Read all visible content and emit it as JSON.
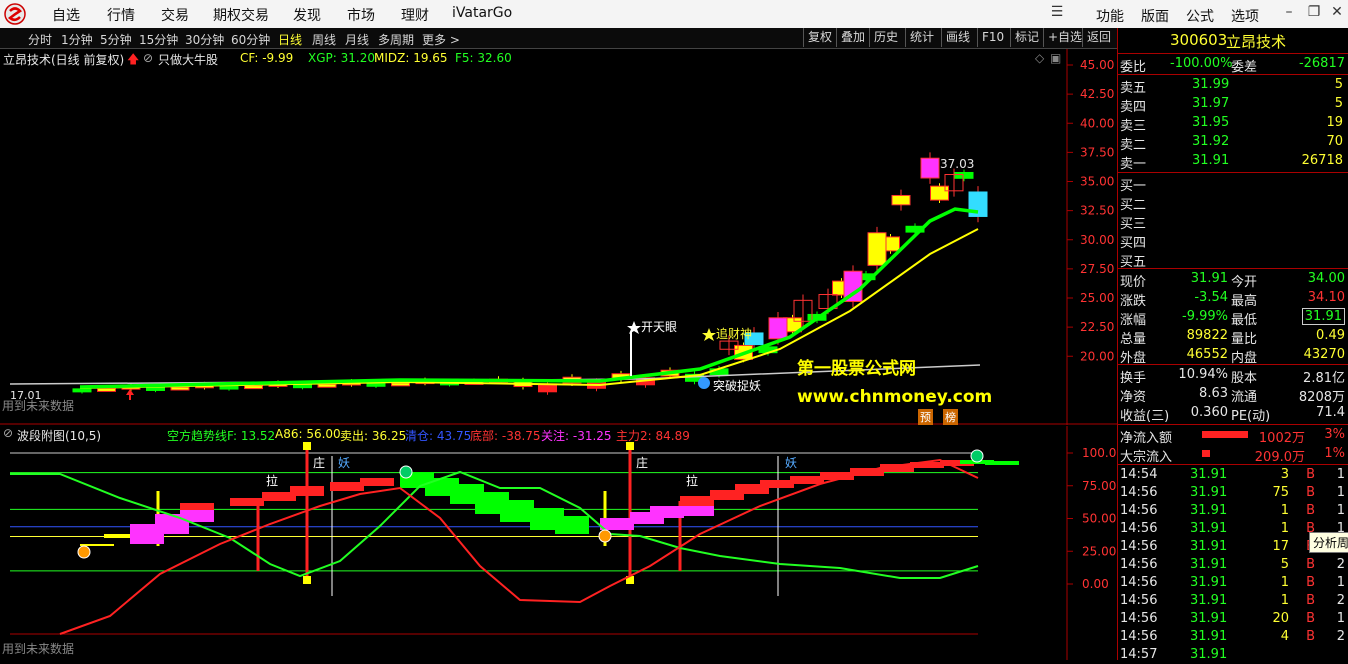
{
  "menu": {
    "items": [
      "自选",
      "行情",
      "交易",
      "期权交易",
      "发现",
      "市场",
      "理财",
      "iVatarGo"
    ],
    "right_items": [
      "功能",
      "版面",
      "公式",
      "选项"
    ]
  },
  "periods": [
    "分时",
    "1分钟",
    "5分钟",
    "15分钟",
    "30分钟",
    "60分钟",
    "日线",
    "周线",
    "月线",
    "多周期",
    "更多 >"
  ],
  "active_period": "日线",
  "toolbar_buttons": [
    "复权",
    "叠加",
    "历史",
    "统计",
    "画线",
    "F10",
    "标记",
    "+自选",
    "返回"
  ],
  "main_header": {
    "title": "立昂技术(日线 前复权)",
    "formula": "只做大牛股",
    "cf": "CF: -9.99",
    "xgp": "XGP: 31.20",
    "midz": "MIDZ: 19.65",
    "f5": "F5: 32.60"
  },
  "main_axis": [
    "45.00",
    "42.50",
    "40.00",
    "37.50",
    "35.00",
    "32.50",
    "30.00",
    "27.50",
    "25.00",
    "22.50",
    "20.00"
  ],
  "main_annotations": {
    "high_label": "37.03",
    "low_label": "17.01",
    "kaitianyan": "开天眼",
    "zhuicaishen": "追财神",
    "tupo": "突破捉妖",
    "future_note": "用到未来数据",
    "watermark_cn": "第一股票公式网",
    "watermark_en": "www.chnmoney.com",
    "badge1": "预",
    "badge2": "榜"
  },
  "sub_header": {
    "title": "波段附图(10,5)",
    "kf": "空方趋势线F: 13.52",
    "a86": "A86: 56.00",
    "maichu": "卖出: 36.25",
    "qingcang": "清仓: 43.75",
    "dibu": "底部: -38.75",
    "guanzhu": "关注: -31.25",
    "zhuli": "主力2: 84.89"
  },
  "sub_axis": [
    "100.0",
    "75.00",
    "50.00",
    "25.00",
    "0.00"
  ],
  "sub_annotations": {
    "zhuang": "庄",
    "yao": "妖",
    "la": "拉",
    "future_note": "用到未来数据"
  },
  "quote": {
    "code": "300603",
    "name": "立昂技术",
    "weibi_label": "委比",
    "weibi": "-100.00%",
    "weicha_label": "委差",
    "weicha": "-26817",
    "asks": [
      {
        "label": "卖五",
        "price": "31.99",
        "vol": "5"
      },
      {
        "label": "卖四",
        "price": "31.97",
        "vol": "5"
      },
      {
        "label": "卖三",
        "price": "31.95",
        "vol": "19"
      },
      {
        "label": "卖二",
        "price": "31.92",
        "vol": "70"
      },
      {
        "label": "卖一",
        "price": "31.91",
        "vol": "26718"
      }
    ],
    "bids": [
      "买一",
      "买二",
      "买三",
      "买四",
      "买五"
    ],
    "stats": [
      {
        "l1": "现价",
        "v1": "31.91",
        "l2": "今开",
        "v2": "34.00"
      },
      {
        "l1": "涨跌",
        "v1": "-3.54",
        "l2": "最高",
        "v2": "34.10"
      },
      {
        "l1": "涨幅",
        "v1": "-9.99%",
        "l2": "最低",
        "v2": "31.91"
      },
      {
        "l1": "总量",
        "v1": "89822",
        "l2": "量比",
        "v2": "0.49"
      },
      {
        "l1": "外盘",
        "v1": "46552",
        "l2": "内盘",
        "v2": "43270"
      }
    ],
    "stats2": [
      {
        "l1": "换手",
        "v1": "10.94%",
        "l2": "股本",
        "v2": "2.81亿"
      },
      {
        "l1": "净资",
        "v1": "8.63",
        "l2": "流通",
        "v2": "8208万"
      },
      {
        "l1": "收益(三)",
        "v1": "0.360",
        "l2": "PE(动)",
        "v2": "71.4"
      }
    ],
    "flows": [
      {
        "label": "净流入额",
        "value": "1002万",
        "pct": "3%"
      },
      {
        "label": "大宗流入",
        "value": "209.0万",
        "pct": "1%"
      }
    ],
    "ticks": [
      {
        "time": "14:54",
        "price": "31.91",
        "vol": "3",
        "side": "B",
        "n": "1"
      },
      {
        "time": "14:56",
        "price": "31.91",
        "vol": "75",
        "side": "B",
        "n": "1"
      },
      {
        "time": "14:56",
        "price": "31.91",
        "vol": "1",
        "side": "B",
        "n": "1"
      },
      {
        "time": "14:56",
        "price": "31.91",
        "vol": "1",
        "side": "B",
        "n": "1"
      },
      {
        "time": "14:56",
        "price": "31.91",
        "vol": "17",
        "side": "B",
        "n": "1"
      },
      {
        "time": "14:56",
        "price": "31.91",
        "vol": "5",
        "side": "B",
        "n": "2"
      },
      {
        "time": "14:56",
        "price": "31.91",
        "vol": "1",
        "side": "B",
        "n": "1"
      },
      {
        "time": "14:56",
        "price": "31.91",
        "vol": "1",
        "side": "B",
        "n": "2"
      },
      {
        "time": "14:56",
        "price": "31.91",
        "vol": "20",
        "side": "B",
        "n": "1"
      },
      {
        "time": "14:56",
        "price": "31.91",
        "vol": "4",
        "side": "B",
        "n": "2"
      },
      {
        "time": "14:57",
        "price": "31.91",
        "vol": "",
        "side": "",
        "n": ""
      }
    ],
    "tooltip": "分析周"
  },
  "colors": {
    "up": "#ff2222",
    "down": "#00ff00",
    "ma1": "#00ff00",
    "ma2": "#ffff00",
    "axis_border": "#aa0000"
  }
}
